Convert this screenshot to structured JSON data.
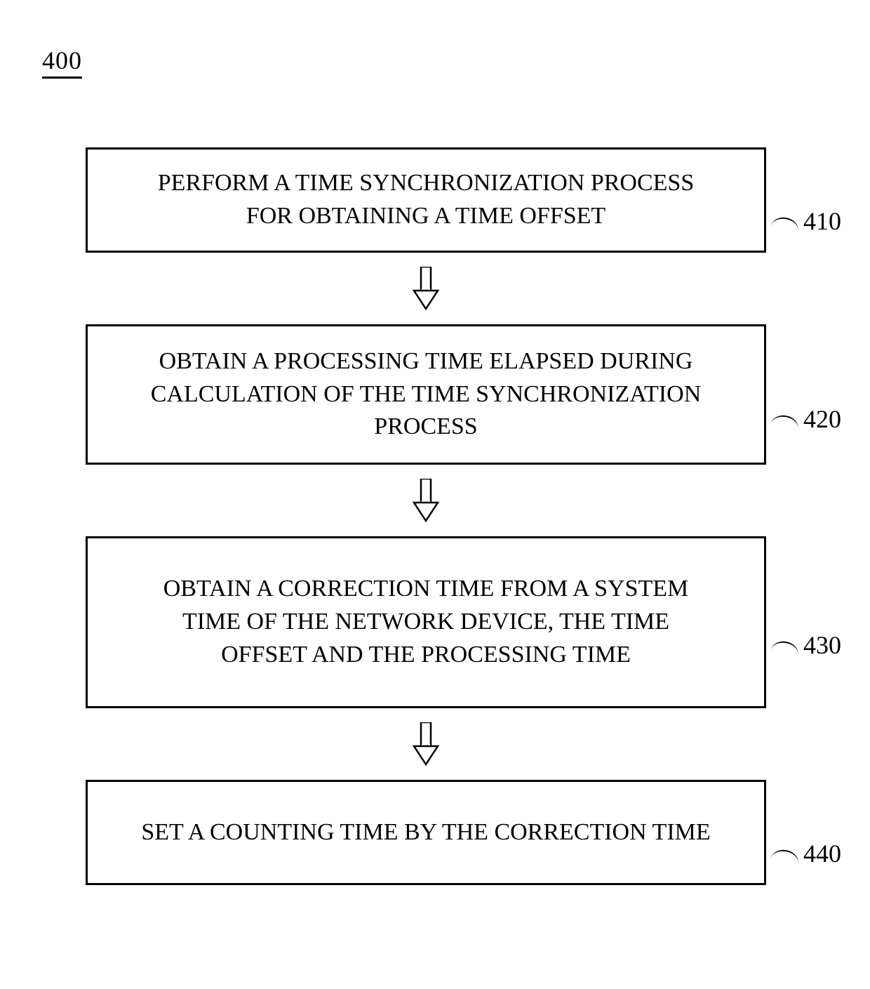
{
  "figure_number": "400",
  "steps": [
    {
      "id": "410",
      "text": "PERFORM A TIME SYNCHRONIZATION PROCESS FOR OBTAINING A TIME OFFSET"
    },
    {
      "id": "420",
      "text": "OBTAIN A PROCESSING TIME ELAPSED DURING CALCULATION OF THE TIME SYNCHRONIZATION PROCESS"
    },
    {
      "id": "430",
      "text": "OBTAIN A CORRECTION TIME FROM A SYSTEM TIME OF THE NETWORK DEVICE, THE TIME OFFSET AND THE PROCESSING TIME"
    },
    {
      "id": "440",
      "text": "SET A COUNTING TIME BY THE CORRECTION TIME"
    }
  ]
}
